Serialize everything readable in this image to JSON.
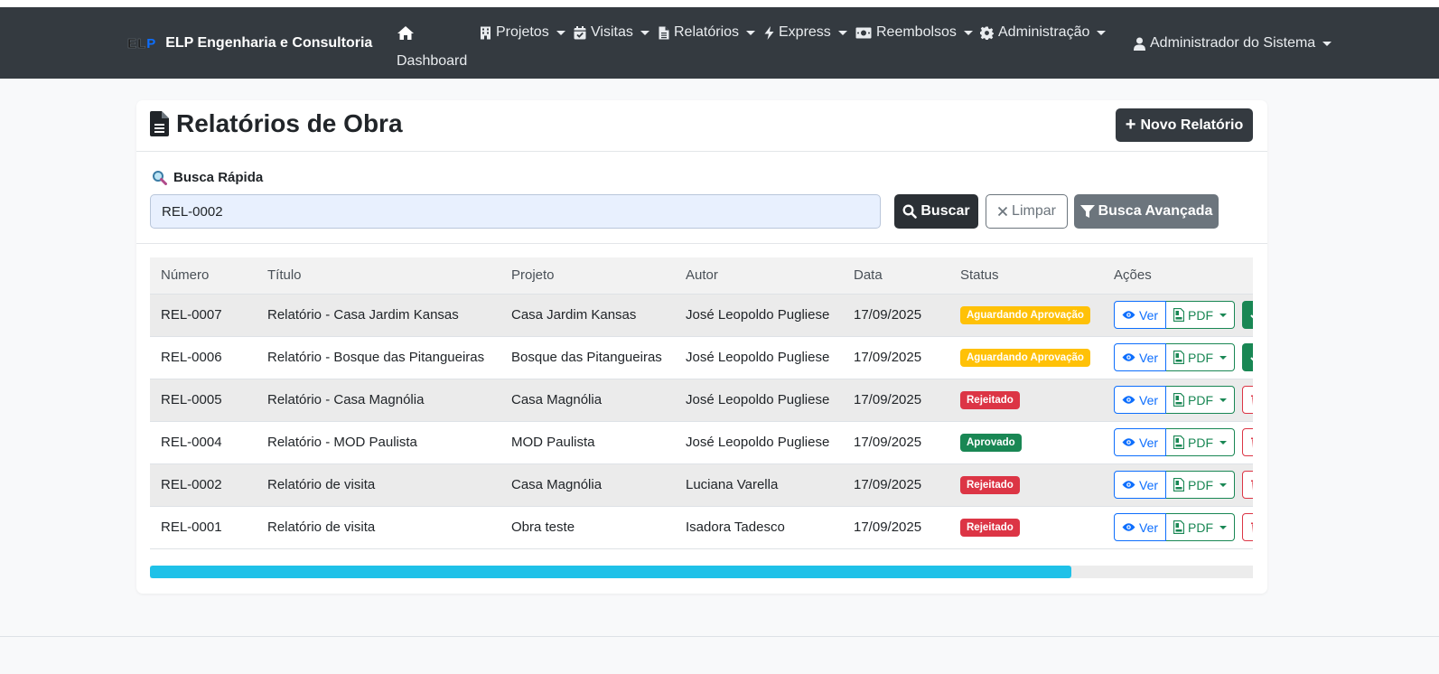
{
  "nav": {
    "brand_logo": "ELP",
    "brand_name": "ELP Engenharia e Consultoria",
    "dashboard": "Dashboard",
    "menus": [
      {
        "label": "Projetos",
        "icon": "building-icon"
      },
      {
        "label": "Visitas",
        "icon": "calendar-check-icon"
      },
      {
        "label": "Relatórios",
        "icon": "file-icon"
      },
      {
        "label": "Express",
        "icon": "bolt-icon"
      },
      {
        "label": "Reembolsos",
        "icon": "money-icon"
      },
      {
        "label": "Administração",
        "icon": "gear-icon"
      }
    ],
    "user": "Administrador do Sistema"
  },
  "page": {
    "title": "Relatórios de Obra",
    "new_button": "Novo Relatório"
  },
  "search": {
    "label": "Busca Rápida",
    "value": "REL-0002",
    "search_button": "Buscar",
    "clear_button": "Limpar",
    "advanced_button": "Busca Avançada"
  },
  "table": {
    "headers": [
      "Número",
      "Título",
      "Projeto",
      "Autor",
      "Data",
      "Status",
      "Ações"
    ],
    "rows": [
      {
        "numero": "REL-0007",
        "titulo": "Relatório - Casa Jardim Kansas",
        "projeto": "Casa Jardim Kansas",
        "autor": "José Leopoldo Pugliese",
        "data": "17/09/2025",
        "status": "Aguardando Aprovação"
      },
      {
        "numero": "REL-0006",
        "titulo": "Relatório - Bosque das Pitangueiras",
        "projeto": "Bosque das Pitangueiras",
        "autor": "José Leopoldo Pugliese",
        "data": "17/09/2025",
        "status": "Aguardando Aprovação"
      },
      {
        "numero": "REL-0005",
        "titulo": "Relatório - Casa Magnólia",
        "projeto": "Casa Magnólia",
        "autor": "José Leopoldo Pugliese",
        "data": "17/09/2025",
        "status": "Rejeitado"
      },
      {
        "numero": "REL-0004",
        "titulo": "Relatório - MOD Paulista",
        "projeto": "MOD Paulista",
        "autor": "José Leopoldo Pugliese",
        "data": "17/09/2025",
        "status": "Aprovado"
      },
      {
        "numero": "REL-0002",
        "titulo": "Relatório de visita",
        "projeto": "Casa Magnólia",
        "autor": "Luciana Varella",
        "data": "17/09/2025",
        "status": "Rejeitado"
      },
      {
        "numero": "REL-0001",
        "titulo": "Relatório de visita",
        "projeto": "Obra teste",
        "autor": "Isadora Tadesco",
        "data": "17/09/2025",
        "status": "Rejeitado"
      }
    ],
    "action_view": "Ver",
    "action_pdf": "PDF"
  },
  "status_colors": {
    "Aguardando Aprovação": "#ffc107",
    "Rejeitado": "#dc3545",
    "Aprovado": "#198754"
  },
  "scroll": {
    "visible_fraction": 0.835
  }
}
